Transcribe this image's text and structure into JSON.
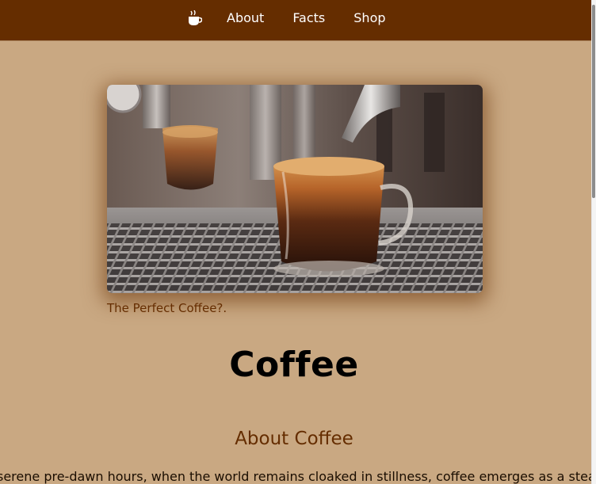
{
  "nav": {
    "logo_icon": "coffee-cup-icon",
    "links": [
      "About",
      "Facts",
      "Shop"
    ]
  },
  "hero": {
    "image_subject": "espresso-cup-on-machine-grate",
    "caption": "The Perfect Coffee?."
  },
  "main": {
    "title": "Coffee",
    "section_title": "About Coffee",
    "paragraph": "serene pre-dawn hours, when the world remains cloaked in stillness, coffee emerges as a steadfast"
  },
  "colors": {
    "navbar_bg": "#652d00",
    "page_bg": "#c9a882",
    "accent_text": "#652d00"
  }
}
